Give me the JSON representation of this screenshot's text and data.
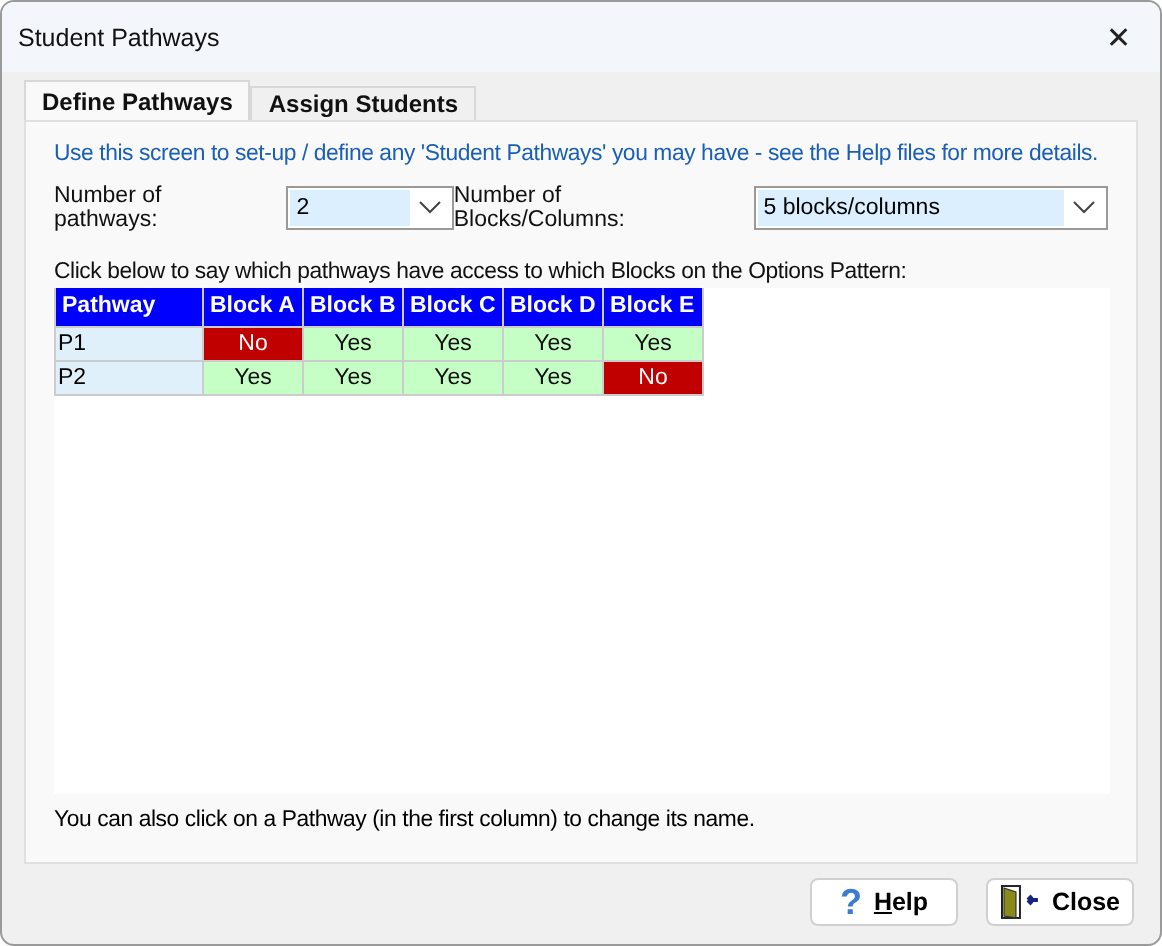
{
  "window": {
    "title": "Student Pathways",
    "close_glyph": "✕"
  },
  "tabs": [
    {
      "label": "Define Pathways",
      "selected": true
    },
    {
      "label": "Assign Students",
      "selected": false
    }
  ],
  "intro": "Use this screen to set-up / define any 'Student Pathways' you may have - see the Help files for more details.",
  "pathways_field": {
    "label": "Number of pathways:",
    "value": "2"
  },
  "blocks_field": {
    "label": "Number of Blocks/Columns:",
    "value": "5 blocks/columns"
  },
  "grid_instruction": "Click below to say which pathways have access to which Blocks on the Options Pattern:",
  "table": {
    "columns": [
      "Pathway",
      "Block A",
      "Block B",
      "Block C",
      "Block D",
      "Block E"
    ],
    "rows": [
      {
        "cells": [
          {
            "kind": "pathway",
            "text": "P1"
          },
          {
            "kind": "access",
            "text": "No",
            "access": false
          },
          {
            "kind": "access",
            "text": "Yes",
            "access": true
          },
          {
            "kind": "access",
            "text": "Yes",
            "access": true
          },
          {
            "kind": "access",
            "text": "Yes",
            "access": true
          },
          {
            "kind": "access",
            "text": "Yes",
            "access": true
          }
        ]
      },
      {
        "cells": [
          {
            "kind": "pathway",
            "text": "P2"
          },
          {
            "kind": "access",
            "text": "Yes",
            "access": true
          },
          {
            "kind": "access",
            "text": "Yes",
            "access": true
          },
          {
            "kind": "access",
            "text": "Yes",
            "access": true
          },
          {
            "kind": "access",
            "text": "Yes",
            "access": true
          },
          {
            "kind": "access",
            "text": "No",
            "access": false
          }
        ]
      }
    ]
  },
  "footer_note": "You can also click on a Pathway (in the first column) to change its name.",
  "buttons": [
    {
      "kind": "help",
      "label": "Help",
      "glyph": "?"
    },
    {
      "kind": "close",
      "label": "Close"
    }
  ]
}
